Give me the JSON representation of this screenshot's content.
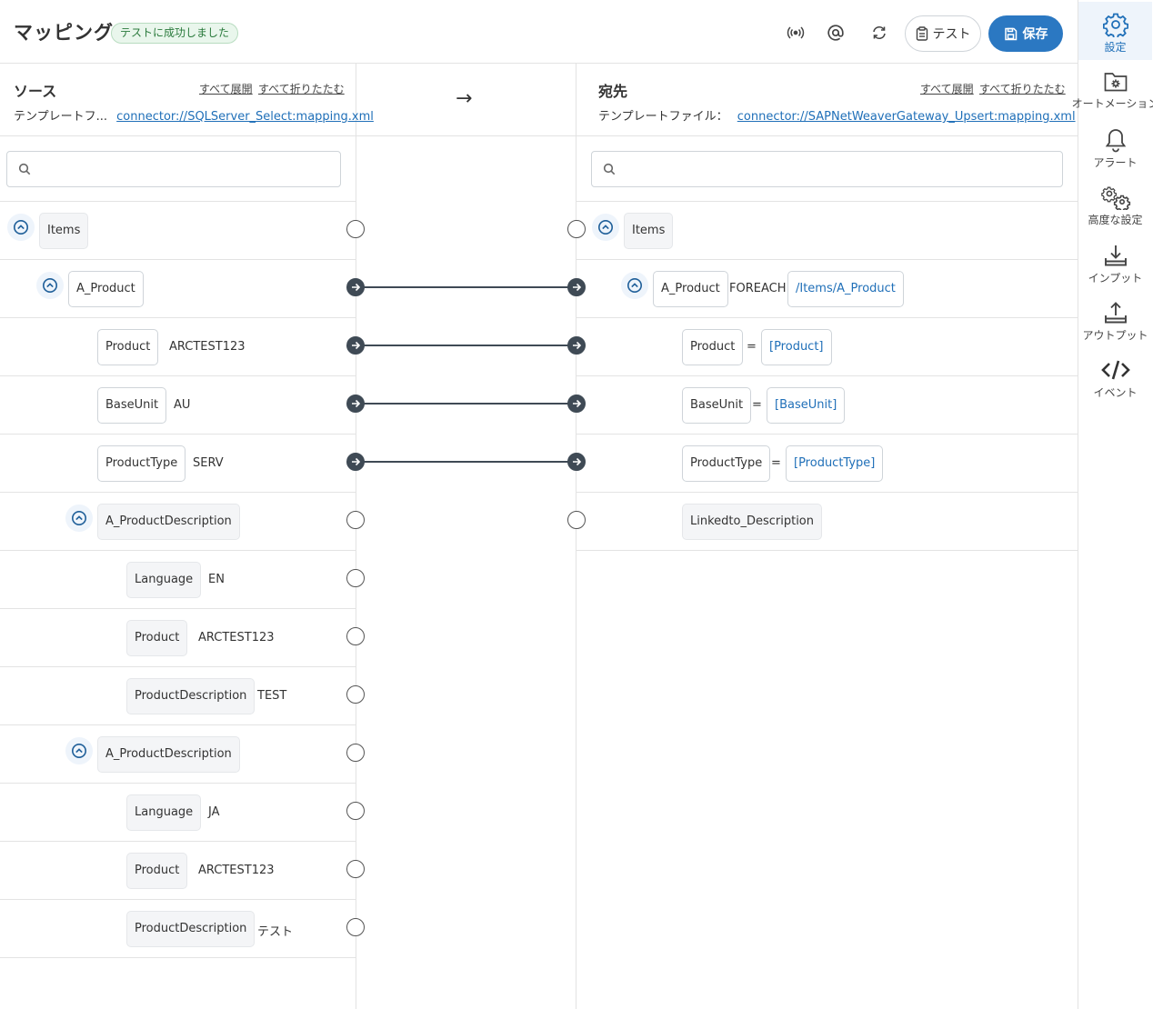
{
  "header": {
    "title": "マッピング",
    "status": "テストに成功しました",
    "icons": [
      "broadcast-icon",
      "at-icon",
      "refresh-icon"
    ],
    "test_label": "テスト",
    "save_label": "保存"
  },
  "sidebar": {
    "items": [
      {
        "label": "設定",
        "icon": "gear-icon",
        "active": true
      },
      {
        "label": "オートメーション",
        "icon": "folder-gear-icon"
      },
      {
        "label": "アラート",
        "icon": "bell-icon"
      },
      {
        "label": "高度な設定",
        "icon": "gears-icon"
      },
      {
        "label": "インプット",
        "icon": "download-icon"
      },
      {
        "label": "アウトプット",
        "icon": "upload-icon"
      },
      {
        "label": "イベント",
        "icon": "code-icon"
      }
    ]
  },
  "source": {
    "title": "ソース",
    "expand_all": "すべて展開",
    "collapse_all": "すべて折りたたむ",
    "template_label": "テンプレートフ...",
    "template_link": "connector://SQLServer_Select:mapping.xml",
    "search_placeholder": "",
    "rows": [
      {
        "name": "Items",
        "value": ""
      },
      {
        "name": "A_Product",
        "value": ""
      },
      {
        "name": "Product",
        "value": "ARCTEST123"
      },
      {
        "name": "BaseUnit",
        "value": "AU"
      },
      {
        "name": "ProductType",
        "value": "SERV"
      },
      {
        "name": "A_ProductDescription",
        "value": ""
      },
      {
        "name": "Language",
        "value": "EN"
      },
      {
        "name": "Product",
        "value": "ARCTEST123"
      },
      {
        "name": "ProductDescription",
        "value": "TEST"
      },
      {
        "name": "A_ProductDescription",
        "value": ""
      },
      {
        "name": "Language",
        "value": "JA"
      },
      {
        "name": "Product",
        "value": "ARCTEST123"
      },
      {
        "name": "ProductDescription",
        "value": "テスト"
      }
    ]
  },
  "destination": {
    "title": "宛先",
    "expand_all": "すべて展開",
    "collapse_all": "すべて折りたたむ",
    "template_label": "テンプレートファイル：",
    "template_link": "connector://SAPNetWeaverGateway_Upsert:mapping.xml",
    "search_placeholder": "",
    "rows": [
      {
        "name": "Items"
      },
      {
        "name": "A_Product",
        "keyword": "FOREACH",
        "expr": "/Items/A_Product"
      },
      {
        "name": "Product",
        "eq": "=",
        "expr": "[Product]"
      },
      {
        "name": "BaseUnit",
        "eq": "=",
        "expr": "[BaseUnit]"
      },
      {
        "name": "ProductType",
        "eq": "=",
        "expr": "[ProductType]"
      },
      {
        "name": "Linkedto_Description"
      }
    ]
  },
  "mapping_arrow": "→"
}
